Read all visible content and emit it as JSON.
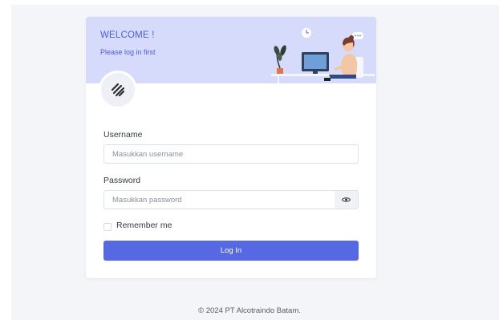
{
  "header": {
    "title": "WELCOME !",
    "subtitle": "Please log in first",
    "illustration": "person-at-desk-illustration",
    "logo": "company-logo-icon"
  },
  "form": {
    "username_label": "Username",
    "username_placeholder": "Masukkan username",
    "username_value": "",
    "password_label": "Password",
    "password_placeholder": "Masukkan password",
    "password_value": "",
    "show_password_icon": "eye-icon",
    "remember_label": "Remember me",
    "remember_checked": false,
    "submit_label": "Log In"
  },
  "footer": {
    "copyright": "© 2024 PT Alcotraindo Batam."
  },
  "colors": {
    "accent": "#5669e2",
    "header_bg": "#d6dbfb",
    "page_bg": "#f4f5f9"
  }
}
